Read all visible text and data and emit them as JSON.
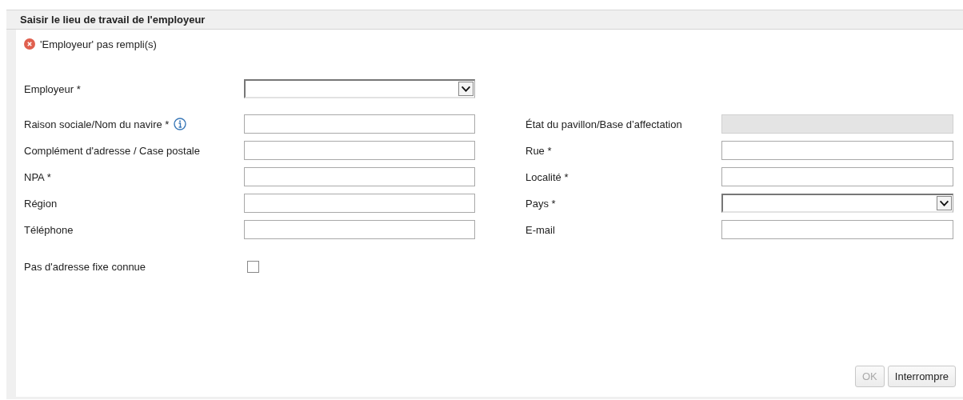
{
  "dialog": {
    "title": "Saisir le lieu de travail de l'employeur"
  },
  "error": {
    "message": "'Employeur' pas rempli(s)"
  },
  "employer": {
    "label": "Employeur *",
    "kind": "select"
  },
  "rows": [
    {
      "left": {
        "label": "Raison sociale/Nom du navire *",
        "kind": "text",
        "info": true,
        "disabled": false
      },
      "right": {
        "label": "État du pavillon/Base d’affectation",
        "kind": "text",
        "info": false,
        "disabled": true
      }
    },
    {
      "left": {
        "label": "Complément d'adresse / Case postale",
        "kind": "text",
        "info": false,
        "disabled": false
      },
      "right": {
        "label": "Rue *",
        "kind": "text",
        "info": false,
        "disabled": false
      }
    },
    {
      "left": {
        "label": "NPA *",
        "kind": "text",
        "info": false,
        "disabled": false
      },
      "right": {
        "label": "Localité *",
        "kind": "text",
        "info": false,
        "disabled": false
      }
    },
    {
      "left": {
        "label": "Région",
        "kind": "text",
        "info": false,
        "disabled": false
      },
      "right": {
        "label": "Pays *",
        "kind": "select",
        "info": false,
        "disabled": false
      }
    },
    {
      "left": {
        "label": "Téléphone",
        "kind": "text",
        "info": false,
        "disabled": false
      },
      "right": {
        "label": "E-mail",
        "kind": "text",
        "info": false,
        "disabled": false
      }
    }
  ],
  "no_fixed_address": {
    "label": "Pas d'adresse fixe connue",
    "checked": false
  },
  "buttons": [
    {
      "label": "OK",
      "disabled": true
    },
    {
      "label": "Interrompre",
      "disabled": false
    }
  ]
}
